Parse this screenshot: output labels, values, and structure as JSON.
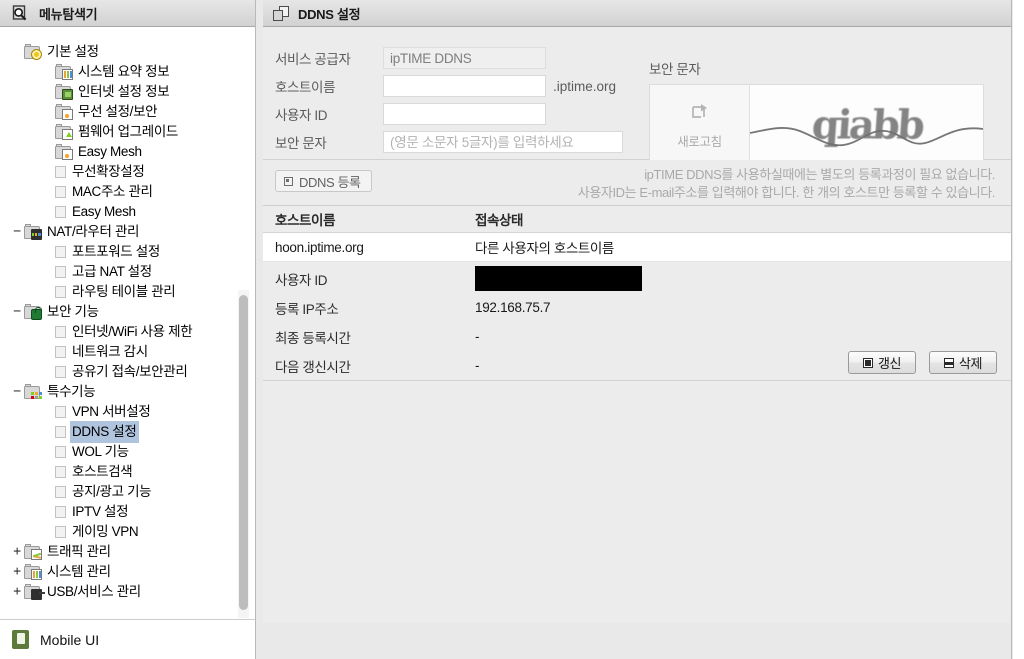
{
  "sidebar": {
    "header": {
      "title": "메뉴탐색기",
      "icon": "search-document-icon"
    },
    "tree": [
      {
        "label": "기본 설정",
        "level": 0,
        "type": "folder",
        "badge": "b-gear",
        "twisty": "",
        "selected": false
      },
      {
        "label": "시스템 요약 정보",
        "level": 1,
        "type": "icon",
        "badge": "b-chart",
        "twisty": "",
        "selected": false
      },
      {
        "label": "인터넷 설정 정보",
        "level": 1,
        "type": "icon",
        "badge": "b-monitor",
        "twisty": "",
        "selected": false
      },
      {
        "label": "무선 설정/보안",
        "level": 1,
        "type": "icon",
        "badge": "b-wifi",
        "twisty": "",
        "selected": false
      },
      {
        "label": "펌웨어 업그레이드",
        "level": 1,
        "type": "icon",
        "badge": "b-up",
        "twisty": "",
        "selected": false
      },
      {
        "label": "Easy Mesh",
        "level": 1,
        "type": "icon",
        "badge": "b-wifi",
        "twisty": "",
        "selected": false
      },
      {
        "label": "무선확장설정",
        "level": 1,
        "type": "square",
        "badge": "",
        "twisty": "",
        "selected": false
      },
      {
        "label": "MAC주소 관리",
        "level": 1,
        "type": "square",
        "badge": "",
        "twisty": "",
        "selected": false
      },
      {
        "label": "Easy Mesh",
        "level": 1,
        "type": "square",
        "badge": "",
        "twisty": "",
        "selected": false
      },
      {
        "label": "NAT/라우터 관리",
        "level": 0,
        "type": "folder",
        "badge": "b-router",
        "twisty": "−",
        "selected": false
      },
      {
        "label": "포트포워드 설정",
        "level": 1,
        "type": "square",
        "badge": "",
        "twisty": "",
        "selected": false
      },
      {
        "label": "고급 NAT 설정",
        "level": 1,
        "type": "square",
        "badge": "",
        "twisty": "",
        "selected": false
      },
      {
        "label": "라우팅 테이블 관리",
        "level": 1,
        "type": "square",
        "badge": "",
        "twisty": "",
        "selected": false
      },
      {
        "label": "보안 기능",
        "level": 0,
        "type": "folder",
        "badge": "b-lock",
        "twisty": "−",
        "selected": false
      },
      {
        "label": "인터넷/WiFi 사용 제한",
        "level": 1,
        "type": "square",
        "badge": "",
        "twisty": "",
        "selected": false
      },
      {
        "label": "네트워크 감시",
        "level": 1,
        "type": "square",
        "badge": "",
        "twisty": "",
        "selected": false
      },
      {
        "label": "공유기 접속/보안관리",
        "level": 1,
        "type": "square",
        "badge": "",
        "twisty": "",
        "selected": false
      },
      {
        "label": "특수기능",
        "level": 0,
        "type": "folder",
        "badge": "b-special",
        "twisty": "−",
        "selected": false
      },
      {
        "label": "VPN 서버설정",
        "level": 1,
        "type": "square",
        "badge": "",
        "twisty": "",
        "selected": false
      },
      {
        "label": "DDNS 설정",
        "level": 1,
        "type": "square",
        "badge": "",
        "twisty": "",
        "selected": true
      },
      {
        "label": "WOL 기능",
        "level": 1,
        "type": "square",
        "badge": "",
        "twisty": "",
        "selected": false
      },
      {
        "label": "호스트검색",
        "level": 1,
        "type": "square",
        "badge": "",
        "twisty": "",
        "selected": false
      },
      {
        "label": "공지/광고 기능",
        "level": 1,
        "type": "square",
        "badge": "",
        "twisty": "",
        "selected": false
      },
      {
        "label": "IPTV 설정",
        "level": 1,
        "type": "square",
        "badge": "",
        "twisty": "",
        "selected": false
      },
      {
        "label": "게이밍 VPN",
        "level": 1,
        "type": "square",
        "badge": "",
        "twisty": "",
        "selected": false
      },
      {
        "label": "트래픽 관리",
        "level": 0,
        "type": "folder",
        "badge": "b-traffic",
        "twisty": "+",
        "selected": false
      },
      {
        "label": "시스템 관리",
        "level": 0,
        "type": "folder",
        "badge": "b-chart",
        "twisty": "+",
        "selected": false
      },
      {
        "label": "USB/서비스 관리",
        "level": 0,
        "type": "folder",
        "badge": "b-usb",
        "twisty": "+",
        "selected": false
      }
    ],
    "footer": {
      "label": "Mobile UI",
      "icon": "mobile-phone-icon"
    }
  },
  "main": {
    "header": {
      "title": "DDNS 설정",
      "icon": "window-stack-icon"
    },
    "form": {
      "provider_label": "서비스 공급자",
      "provider_value": "ipTIME DDNS",
      "hostname_label": "호스트이름",
      "hostname_value": "",
      "hostname_placeholder": "",
      "hostname_suffix": ".iptime.org",
      "userid_label": "사용자 ID",
      "userid_value": "",
      "userid_placeholder": "",
      "captcha_label": "보안 문자",
      "captcha_placeholder": "(영문 소문자 5글자)를 입력하세요",
      "captcha_value": ""
    },
    "captcha": {
      "section_label": "보안 문자",
      "refresh_label": "새로고침",
      "refresh_icon": "refresh-arrow-icon",
      "image_text": "qiabb"
    },
    "actions": {
      "register_label": "DDNS 등록",
      "register_icon": "plus-box-icon"
    },
    "notices": [
      "ipTIME DDNS를 사용하실때에는 별도의 등록과정이 필요 없습니다.",
      "사용자ID는 E-mail주소를 입력해야 합니다. 한 개의 호스트만 등록할 수 있습니다."
    ],
    "table": {
      "columns": [
        "호스트이름",
        "접속상태"
      ],
      "rows": [
        {
          "hostname": "hoon.iptime.org",
          "status": "다른 사용자의 호스트이름"
        }
      ]
    },
    "details": [
      {
        "label": "사용자 ID",
        "value": "",
        "redacted": true
      },
      {
        "label": "등록 IP주소",
        "value": "192.168.75.7",
        "redacted": false
      },
      {
        "label": "최종 등록시간",
        "value": "-",
        "redacted": false
      },
      {
        "label": "다음 갱신시간",
        "value": "-",
        "redacted": false
      }
    ],
    "detail_buttons": [
      {
        "label": "갱신",
        "icon": "refresh-small-icon",
        "icon_class": "refresh"
      },
      {
        "label": "삭제",
        "icon": "minus-small-icon",
        "icon_class": "del"
      }
    ]
  },
  "colors": {
    "selection": "#b0c4de",
    "panel_bg": "#ececec",
    "header_bg": "#dcdcdc",
    "border": "#b9b9b9",
    "muted_text": "#a9a9a9",
    "redaction": "#000000"
  }
}
